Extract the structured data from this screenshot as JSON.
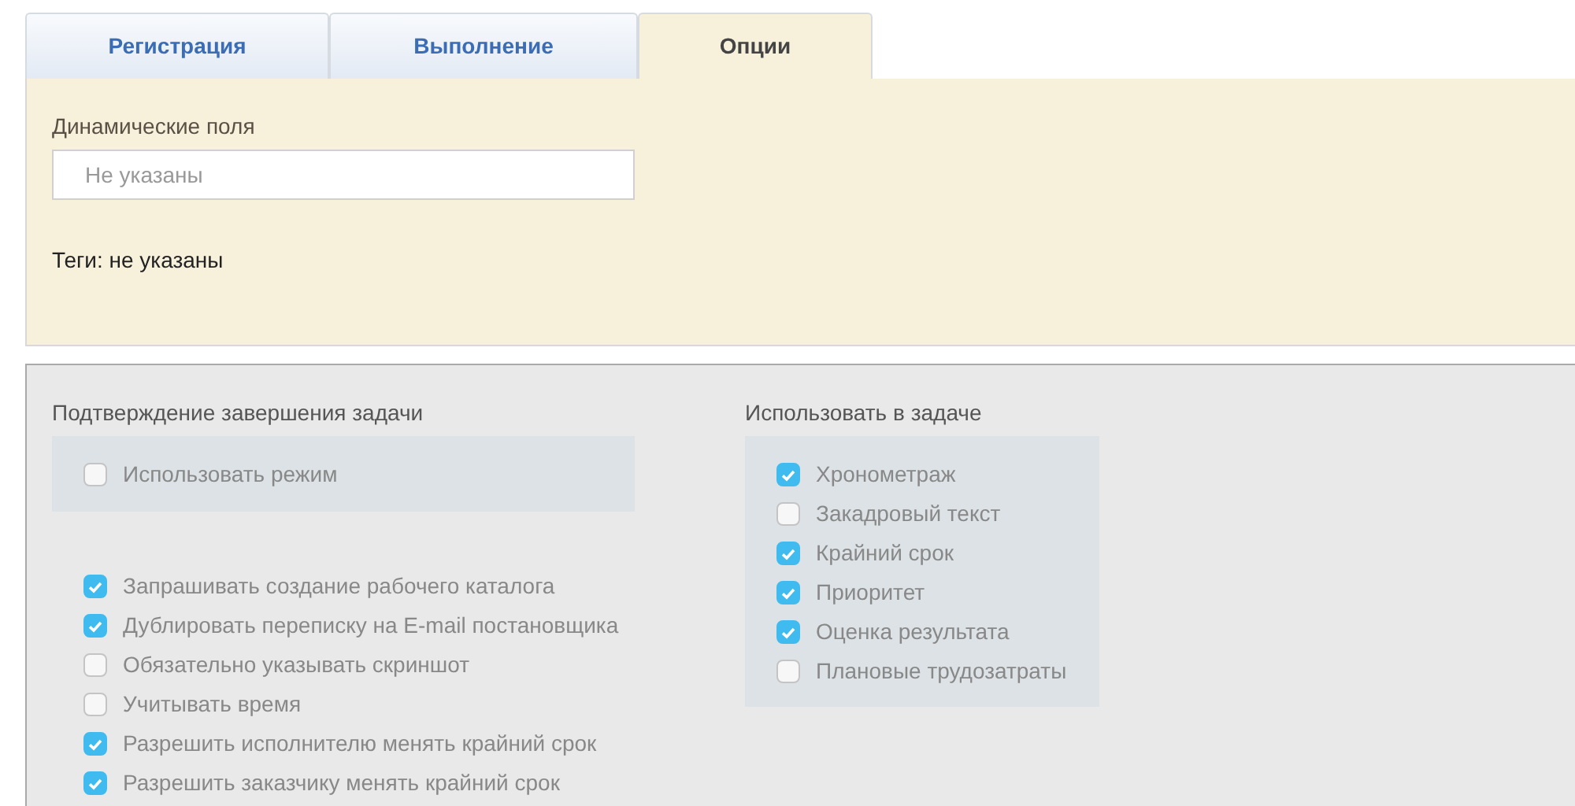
{
  "tabs": [
    {
      "label": "Регистрация",
      "selected": false
    },
    {
      "label": "Выполнение",
      "selected": false
    },
    {
      "label": "Опции",
      "selected": true
    }
  ],
  "options": {
    "dynamic_fields": {
      "label": "Динамические поля",
      "placeholder": "Не указаны"
    },
    "tags": "Теги: не указаны"
  },
  "completion": {
    "title": "Подтверждение завершения задачи",
    "mode": {
      "label": "Использовать режим",
      "checked": false
    },
    "settings": [
      {
        "label": "Запрашивать создание рабочего каталога",
        "checked": true
      },
      {
        "label": "Дублировать переписку на E-mail постановщика",
        "checked": true
      },
      {
        "label": "Обязательно указывать скриншот",
        "checked": false
      },
      {
        "label": "Учитывать время",
        "checked": false
      },
      {
        "label": "Разрешить исполнителю менять крайний срок",
        "checked": true
      },
      {
        "label": "Разрешить заказчику менять крайний срок",
        "checked": true
      }
    ]
  },
  "use_in_task": {
    "title": "Использовать в задаче",
    "items": [
      {
        "label": "Хронометраж",
        "checked": true
      },
      {
        "label": "Закадровый текст",
        "checked": false
      },
      {
        "label": "Крайний срок",
        "checked": true
      },
      {
        "label": "Приоритет",
        "checked": true
      },
      {
        "label": "Оценка результата",
        "checked": true
      },
      {
        "label": "Плановые трудозатраты",
        "checked": false
      }
    ]
  }
}
